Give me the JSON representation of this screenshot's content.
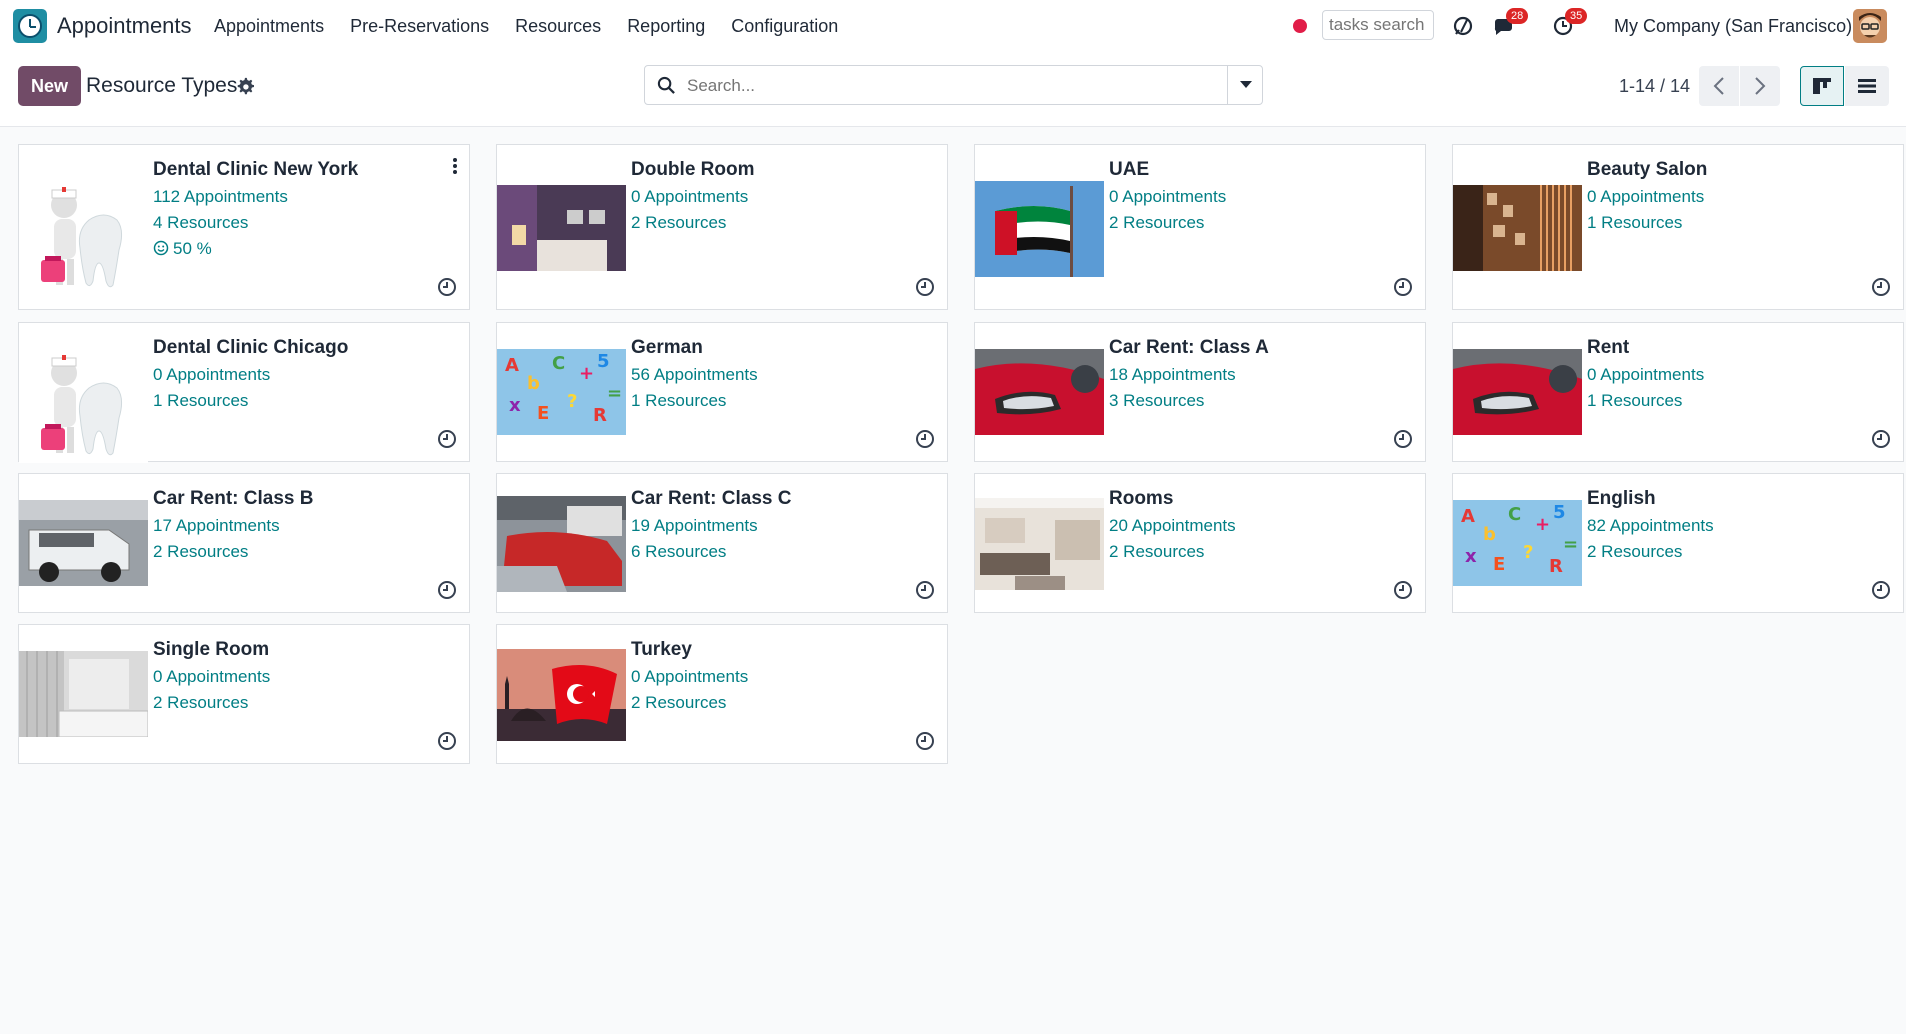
{
  "navbar": {
    "app_name": "Appointments",
    "menu": [
      "Appointments",
      "Pre-Reservations",
      "Resources",
      "Reporting",
      "Configuration"
    ],
    "tasks_search_placeholder": "tasks search",
    "messages_count": "28",
    "activities_count": "35",
    "company": "My Company (San Francisco)"
  },
  "control": {
    "new_label": "New",
    "title": "Resource Types",
    "search_placeholder": "Search...",
    "pager": "1-14 / 14"
  },
  "cards": [
    {
      "title": "Dental Clinic New York",
      "appointments": "112 Appointments",
      "resources": "4 Resources",
      "rating": "50 %",
      "image": "dentist"
    },
    {
      "title": "Double Room",
      "appointments": "0 Appointments",
      "resources": "2 Resources",
      "image": "bedroom-purple"
    },
    {
      "title": "UAE",
      "appointments": "0 Appointments",
      "resources": "2 Resources",
      "image": "uae-flag"
    },
    {
      "title": "Beauty Salon",
      "appointments": "0 Appointments",
      "resources": "1 Resources",
      "image": "salon"
    },
    {
      "title": "Dental Clinic Chicago",
      "appointments": "0 Appointments",
      "resources": "1 Resources",
      "image": "dentist"
    },
    {
      "title": "German",
      "appointments": "56 Appointments",
      "resources": "1 Resources",
      "image": "letters"
    },
    {
      "title": "Car Rent: Class A",
      "appointments": "18 Appointments",
      "resources": "3 Resources",
      "image": "red-car"
    },
    {
      "title": "Rent",
      "appointments": "0 Appointments",
      "resources": "1 Resources",
      "image": "red-car"
    },
    {
      "title": "Car Rent: Class B",
      "appointments": "17 Appointments",
      "resources": "2 Resources",
      "image": "white-suv"
    },
    {
      "title": "Car Rent: Class C",
      "appointments": "19 Appointments",
      "resources": "6 Resources",
      "image": "parking-cars"
    },
    {
      "title": "Rooms",
      "appointments": "20 Appointments",
      "resources": "2 Resources",
      "image": "living-room"
    },
    {
      "title": "English",
      "appointments": "82 Appointments",
      "resources": "2 Resources",
      "image": "letters"
    },
    {
      "title": "Single Room",
      "appointments": "0 Appointments",
      "resources": "2 Resources",
      "image": "bedroom-white"
    },
    {
      "title": "Turkey",
      "appointments": "0 Appointments",
      "resources": "2 Resources",
      "image": "turkey-flag"
    }
  ],
  "colors": {
    "accent": "#017e84",
    "brand": "#714b67",
    "badge": "#dc2626"
  }
}
